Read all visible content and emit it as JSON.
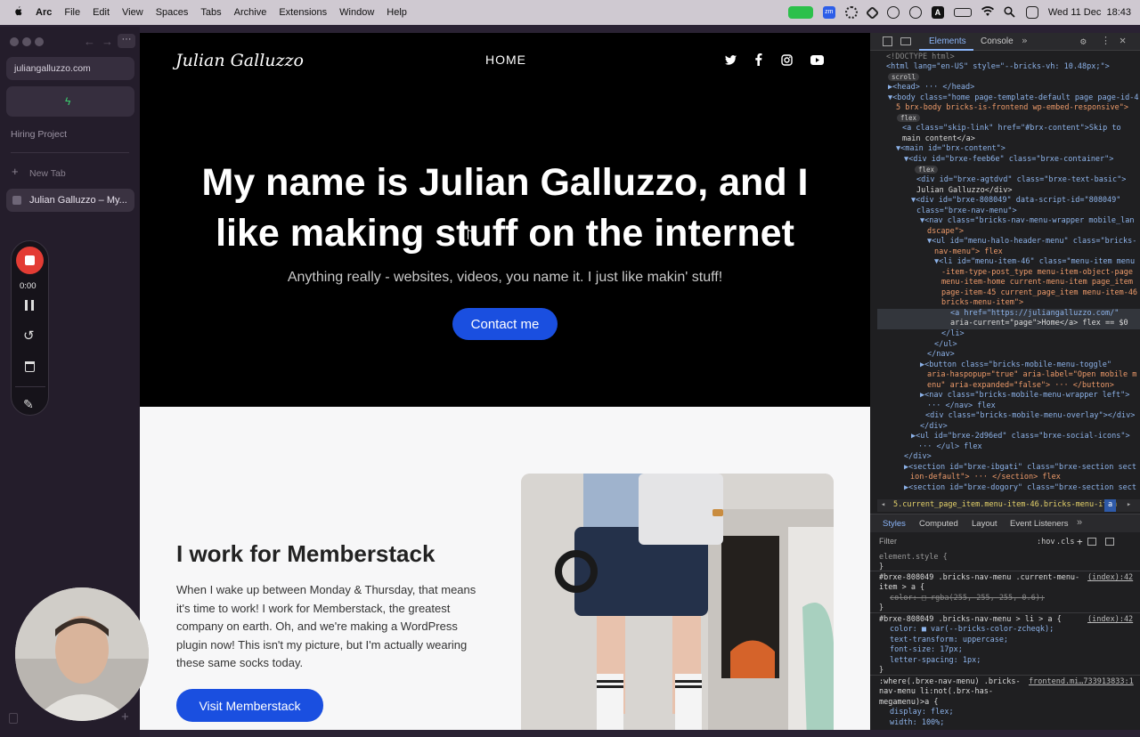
{
  "menubar": {
    "apple": "",
    "app": "Arc",
    "items": [
      "File",
      "Edit",
      "View",
      "Spaces",
      "Tabs",
      "Archive",
      "Extensions",
      "Window",
      "Help"
    ],
    "clock": "Wed 11 Dec  18:43",
    "zm_badge": "zm",
    "a_badge": "A"
  },
  "sidebar": {
    "url": "juliangalluzzo.com",
    "space_label": "Hiring Project",
    "new_tab": "New Tab",
    "active_tab": "Julian Galluzzo – My..."
  },
  "recorder": {
    "timer": "0:00"
  },
  "page": {
    "logo": "Julian Galluzzo",
    "nav_home": "HOME",
    "hero_title": "My name is Julian Galluzzo, and I like making stuff on the internet",
    "hero_sub": "Anything really - websites, videos, you name it. I just like makin' stuff!",
    "contact_btn": "Contact me",
    "s2_title": "I work for Memberstack",
    "s2_body": "When I wake up between Monday & Thursday, that means it's time to work! I work for Memberstack, the greatest company on earth. Oh, and we're making a WordPress plugin now! This isn't my picture, but I'm actually wearing these same socks today.",
    "s2_btn": "Visit Memberstack"
  },
  "devtools": {
    "tabs": [
      "Elements",
      "Console"
    ],
    "breadcrumb": "5.current_page_item.menu-item-46.bricks-menu-item",
    "breadcrumb_tag": "a",
    "styles_tabs": [
      "Styles",
      "Computed",
      "Layout",
      "Event Listeners"
    ],
    "filter_placeholder": "Filter",
    "hov": ":hov",
    "cls": ".cls",
    "dom_lines": [
      "<!DOCTYPE html>",
      "<html lang=\"en-US\" style=\"--bricks-vh: 10.48px;\">",
      "scroll",
      "▶<head> ··· </head>",
      "▼<body class=\"home page-template-default page page-id-4",
      "5 brx-body bricks-is-frontend wp-embed-responsive\">",
      "flex",
      "<a class=\"skip-link\" href=\"#brx-content\">Skip to",
      "main content</a>",
      "▼<main id=\"brx-content\">",
      "▼<div id=\"brxe-feeb6e\" class=\"brxe-container\">",
      "flex",
      "<div id=\"brxe-agtdvd\" class=\"brxe-text-basic\">",
      "Julian Galluzzo</div>",
      "▼<div id=\"brxe-808049\" data-script-id=\"808049\"",
      "class=\"brxe-nav-menu\">",
      "▼<nav class=\"bricks-nav-menu-wrapper mobile_lan",
      "dscape\">",
      "▼<ul id=\"menu-halo-header-menu\" class=\"bricks-",
      "nav-menu\"> flex",
      "▼<li id=\"menu-item-46\" class=\"menu-item menu",
      "-item-type-post_type menu-item-object-page",
      "menu-item-home current-menu-item page_item",
      "page-item-45 current_page_item menu-item-46",
      "bricks-menu-item\">",
      "<a href=\"https://juliangalluzzo.com/\"",
      "aria-current=\"page\">Home</a> flex == $0",
      "</li>",
      "</ul>",
      "</nav>",
      "▶<button class=\"bricks-mobile-menu-toggle\"",
      "aria-haspopup=\"true\" aria-label=\"Open mobile m",
      "enu\" aria-expanded=\"false\"> ··· </button>",
      "▶<nav class=\"bricks-mobile-menu-wrapper left\">",
      "··· </nav> flex",
      "<div class=\"bricks-mobile-menu-overlay\"></div>",
      "</div>",
      "▶<ul id=\"brxe-2d96ed\" class=\"brxe-social-icons\">",
      "··· </ul> flex",
      "</div>",
      "▶<section id=\"brxe-ibgati\" class=\"brxe-section sect",
      "ion-default\"> ··· </section> flex",
      "▶<section id=\"brxe-dogory\" class=\"brxe-section sect"
    ],
    "style_lines": [
      "element.style {",
      "}",
      "#brxe-808049 .bricks-nav-menu .current-menu-",
      "item > a {",
      "color: □ rgba(255, 255, 255, 0.6);",
      "}",
      "#brxe-808049 .bricks-nav-menu > li > a {",
      "color: ■ var(--bricks-color-zcheqk);",
      "text-transform: uppercase;",
      "font-size: 17px;",
      "letter-spacing: 1px;",
      "}",
      ":where(.brxe-nav-menu) .bricks-",
      "nav-menu li:not(.brx-has-",
      "megamenu)>a {",
      "display: flex;",
      "width: 100%;",
      "}"
    ],
    "source_1": "(index):42",
    "source_2": "(index):42",
    "source_3": "frontend.mi…733913833:1"
  }
}
